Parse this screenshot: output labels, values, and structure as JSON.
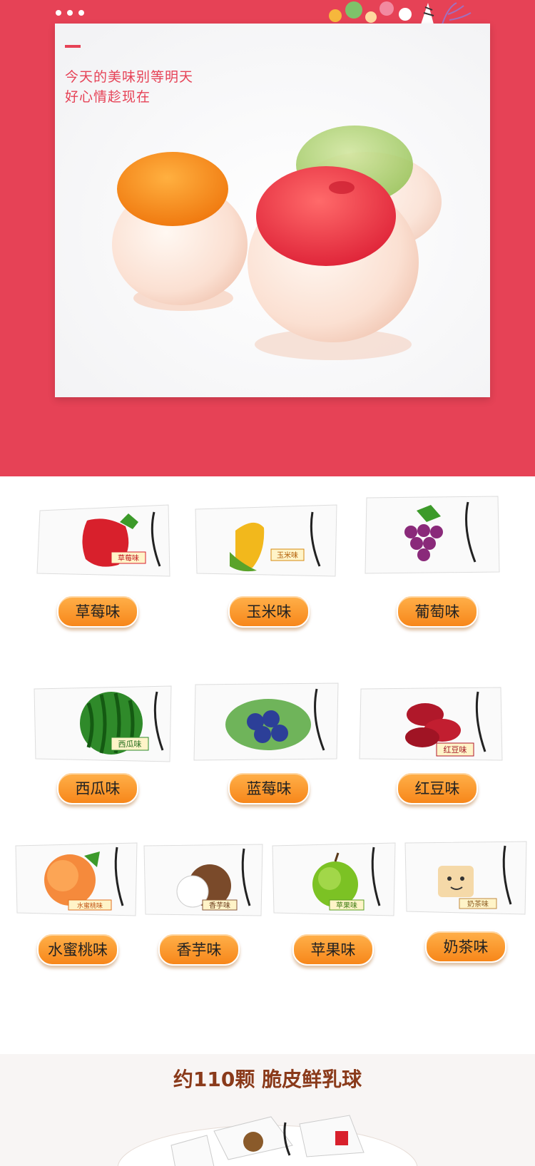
{
  "hero": {
    "line1": "今天的美味别等明天",
    "line2": "好心情趁现在"
  },
  "colors": {
    "hero_bg": "#e64256",
    "pill_top": "#ffb04a",
    "pill_bottom": "#f7871a",
    "title_brown": "#8a3a1a"
  },
  "flavors": [
    {
      "label": "草莓味",
      "pack_label": "草莓味"
    },
    {
      "label": "玉米味",
      "pack_label": "玉米味"
    },
    {
      "label": "葡萄味",
      "pack_label": ""
    },
    {
      "label": "西瓜味",
      "pack_label": "西瓜味"
    },
    {
      "label": "蓝莓味",
      "pack_label": ""
    },
    {
      "label": "红豆味",
      "pack_label": "红豆味"
    },
    {
      "label": "水蜜桃味",
      "pack_label": "水蜜桃味"
    },
    {
      "label": "香芋味",
      "pack_label": "香芋味"
    },
    {
      "label": "苹果味",
      "pack_label": "苹果味"
    },
    {
      "label": "奶茶味",
      "pack_label": "奶茶味"
    }
  ],
  "bottom": {
    "title": "约110颗 脆皮鲜乳球"
  }
}
